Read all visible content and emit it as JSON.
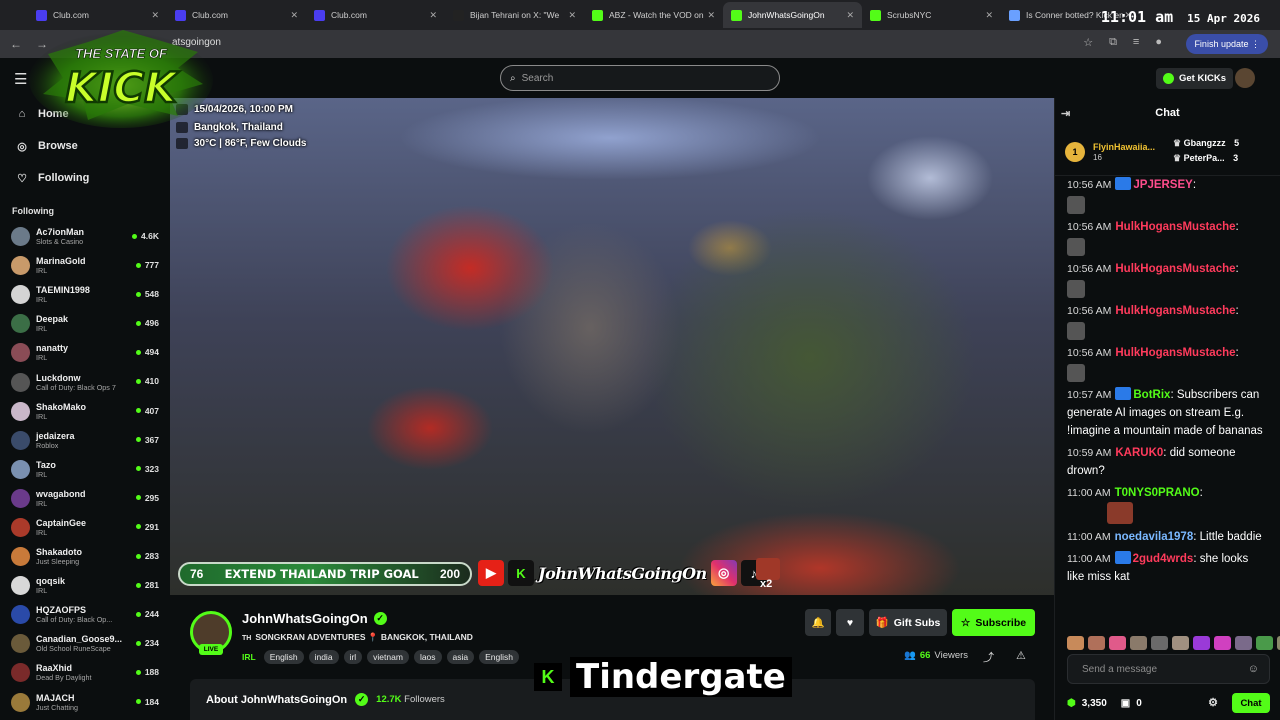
{
  "browser": {
    "tabs": [
      {
        "label": "Club.com",
        "fav": "#4a3df0"
      },
      {
        "label": "Club.com",
        "fav": "#4a3df0"
      },
      {
        "label": "Club.com",
        "fav": "#4a3df0"
      },
      {
        "label": "Bijan Tehrani on X: \"We",
        "fav": "#222"
      },
      {
        "label": "ABZ - Watch the VOD on",
        "fav": "#53fc18"
      },
      {
        "label": "JohnWhatsGoingOn",
        "fav": "#53fc18"
      },
      {
        "label": "ScrubsNYC",
        "fav": "#53fc18"
      },
      {
        "label": "Is Conner botted? Kick en",
        "fav": "#6aa0ff"
      }
    ],
    "clock_time": "11:01 am",
    "clock_date": "15 Apr 2026",
    "url": "atsgoingon",
    "finish_update": "Finish update"
  },
  "logo": {
    "line1": "THE STATE OF",
    "line2": "KICK"
  },
  "search": {
    "placeholder": "Search"
  },
  "get_kicks": "Get KICKs",
  "sidebar": {
    "nav": [
      {
        "label": "Home",
        "icon": "home-icon"
      },
      {
        "label": "Browse",
        "icon": "compass-icon"
      },
      {
        "label": "Following",
        "icon": "heart-icon"
      }
    ],
    "following_header": "Following",
    "following": [
      {
        "name": "Ac7ionMan",
        "cat": "Slots & Casino",
        "viewers": "4.6K",
        "color": "#6b7a89"
      },
      {
        "name": "MarinaGold",
        "cat": "IRL",
        "viewers": "777",
        "color": "#c89a6a"
      },
      {
        "name": "TAEMIN1998",
        "cat": "IRL",
        "viewers": "548",
        "color": "#d4d4d4"
      },
      {
        "name": "Deepak",
        "cat": "IRL",
        "viewers": "496",
        "color": "#3b6e46"
      },
      {
        "name": "nanatty",
        "cat": "IRL",
        "viewers": "494",
        "color": "#8a4c56"
      },
      {
        "name": "Luckdonw",
        "cat": "Call of Duty: Black Ops 7",
        "viewers": "410",
        "color": "#555"
      },
      {
        "name": "ShakoMako",
        "cat": "IRL",
        "viewers": "407",
        "color": "#c9b7c9"
      },
      {
        "name": "jedaizera",
        "cat": "Roblox",
        "viewers": "367",
        "color": "#3a4b6a"
      },
      {
        "name": "Tazo",
        "cat": "IRL",
        "viewers": "323",
        "color": "#7a90b0"
      },
      {
        "name": "wvagabond",
        "cat": "IRL",
        "viewers": "295",
        "color": "#6a3a8a"
      },
      {
        "name": "CaptainGee",
        "cat": "IRL",
        "viewers": "291",
        "color": "#aa3a2a"
      },
      {
        "name": "Shakadoto",
        "cat": "Just Sleeping",
        "viewers": "283",
        "color": "#c87a3a"
      },
      {
        "name": "qoqsik",
        "cat": "IRL",
        "viewers": "281",
        "color": "#d8d8d8"
      },
      {
        "name": "HQZAOFPS",
        "cat": "Call of Duty: Black Op...",
        "viewers": "244",
        "color": "#2a4aa8"
      },
      {
        "name": "Canadian_Goose9...",
        "cat": "Old School RuneScape",
        "viewers": "234",
        "color": "#6a5a3a"
      },
      {
        "name": "RaaXhid",
        "cat": "Dead By Daylight",
        "viewers": "188",
        "color": "#7a2a2a"
      },
      {
        "name": "MAJACH",
        "cat": "Just Chatting",
        "viewers": "184",
        "color": "#9a7a3a"
      }
    ]
  },
  "video": {
    "overlay_datetime": "15/04/2026, 10:00 PM",
    "overlay_location": "Bangkok, Thailand",
    "overlay_weather": "30°C | 86°F, Few Clouds",
    "goal_start": "76",
    "goal_label": "EXTEND THAILAND TRIP GOAL",
    "goal_end": "200",
    "goal_progress_fraction": 0.38,
    "handle": "JohnWhatsGoingOn",
    "multiplier": "x2"
  },
  "channel": {
    "name": "JohnWhatsGoingOn",
    "live": "LIVE",
    "title": "SONGKRAN ADVENTURES 📍 BANGKOK, THAILAND",
    "flag": "TH",
    "category": "IRL",
    "tags": [
      "English",
      "india",
      "irl",
      "vietnam",
      "laos",
      "asia",
      "English"
    ],
    "gift_subs": "Gift Subs",
    "subscribe": "Subscribe",
    "viewers": "66",
    "viewers_label": "Viewers",
    "about": "About JohnWhatsGoingOn",
    "followers": "12.7K",
    "followers_label": "Followers"
  },
  "watermark": {
    "text": "Tindergate"
  },
  "chat": {
    "title": "Chat",
    "pinned": {
      "rank": "1",
      "name": "FlyinHawaiia...",
      "count": "16"
    },
    "top": [
      {
        "name": "Gbangzzz",
        "count": "5"
      },
      {
        "name": "PeterPa...",
        "count": "3"
      }
    ],
    "messages": [
      {
        "ts": "10:56 AM",
        "user": "JPJERSEY",
        "color": "#ff4d8d",
        "text": "",
        "emote": true
      },
      {
        "ts": "10:56 AM",
        "user": "HulkHogansMustache",
        "color": "#ff3b5c",
        "text": "",
        "emote": true
      },
      {
        "ts": "10:56 AM",
        "user": "HulkHogansMustache",
        "color": "#ff3b5c",
        "text": "",
        "emote": true
      },
      {
        "ts": "10:56 AM",
        "user": "HulkHogansMustache",
        "color": "#ff3b5c",
        "text": "",
        "emote": true
      },
      {
        "ts": "10:56 AM",
        "user": "HulkHogansMustache",
        "color": "#ff3b5c",
        "text": "",
        "emote": true
      },
      {
        "ts": "10:57 AM",
        "user": "BotRix",
        "color": "#53fc18",
        "text": "Subscribers can generate AI images on stream E.g. !imagine a mountain made of bananas",
        "emote": false
      },
      {
        "ts": "10:59 AM",
        "user": "KARUK0",
        "color": "#ff3b5c",
        "text": "did someone drown?",
        "emote": false
      },
      {
        "ts": "11:00 AM",
        "user": "T0NYS0PRANO",
        "color": "#53fc18",
        "text": "",
        "emote": false
      },
      {
        "ts": "11:00 AM",
        "user": "noedavila1978",
        "color": "#7ab8ff",
        "text": "Little baddie",
        "emote": false
      },
      {
        "ts": "11:00 AM",
        "user": "2gud4wrds",
        "color": "#ff3b5c",
        "text": "she looks like miss kat",
        "emote": false
      }
    ],
    "send_placeholder": "Send a message",
    "points": "3,350",
    "other_count": "0",
    "chat_button": "Chat"
  }
}
